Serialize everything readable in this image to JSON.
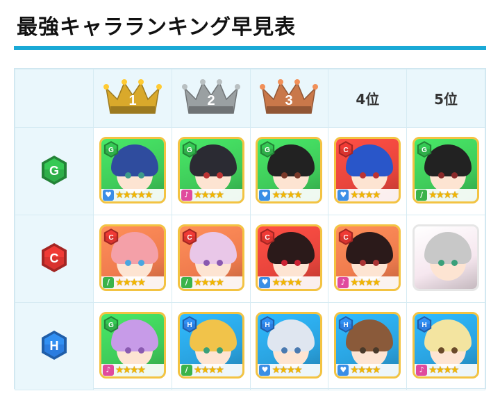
{
  "title": "最強キャラランキング早見表",
  "columns": [
    {
      "rank_label": "1",
      "crown_color": "#d9a92b"
    },
    {
      "rank_label": "2",
      "crown_color": "#9aa0a2"
    },
    {
      "rank_label": "3",
      "crown_color": "#c9784a"
    },
    {
      "rank_label": "4位"
    },
    {
      "rank_label": "5位"
    }
  ],
  "rows": [
    {
      "attr_letter": "G",
      "attr_color": "#2fae49",
      "cards": [
        {
          "attr": "G",
          "type_icon": "heart-icon",
          "type_color": "#3a8ee6",
          "stars": "★★★★★",
          "bg": "#3fcb5a",
          "hair": "#2f4c9e",
          "eye": "#3d9b8a"
        },
        {
          "attr": "G",
          "type_icon": "note-icon",
          "type_color": "#e04a9d",
          "stars": "★★★★",
          "bg": "#3fcb5a",
          "hair": "#2b2b33",
          "eye": "#b33"
        },
        {
          "attr": "G",
          "type_icon": "heart-icon",
          "type_color": "#3a8ee6",
          "stars": "★★★★",
          "bg": "#3fcb5a",
          "hair": "#222",
          "eye": "#7a3a2a"
        },
        {
          "attr": "C",
          "type_icon": "heart-icon",
          "type_color": "#3a8ee6",
          "stars": "★★★★",
          "bg": "#e8453c",
          "hair": "#2956c9",
          "eye": "#b33"
        },
        {
          "attr": "G",
          "type_icon": "sword-icon",
          "type_color": "#3bb34a",
          "stars": "★★★★",
          "bg": "#3fcb5a",
          "hair": "#222",
          "eye": "#8a2a2a"
        }
      ]
    },
    {
      "attr_letter": "C",
      "attr_color": "#d9332e",
      "cards": [
        {
          "attr": "C",
          "type_icon": "sword-icon",
          "type_color": "#3bb34a",
          "stars": "★★★★",
          "bg": "#f07c4e",
          "hair": "#f4a0a8",
          "eye": "#4aa6e0"
        },
        {
          "attr": "C",
          "type_icon": "sword-icon",
          "type_color": "#3bb34a",
          "stars": "★★★★",
          "bg": "#f07c4e",
          "hair": "#e9c7e8",
          "eye": "#8a5ab0"
        },
        {
          "attr": "C",
          "type_icon": "heart-icon",
          "type_color": "#3a8ee6",
          "stars": "★★★★",
          "bg": "#e8453c",
          "hair": "#2b1a1a",
          "eye": "#c23"
        },
        {
          "attr": "C",
          "type_icon": "note-icon",
          "type_color": "#e04a9d",
          "stars": "★★★★",
          "bg": "#f07c4e",
          "hair": "#2b1a1a",
          "eye": "#a33"
        },
        {
          "attr": "",
          "type_icon": "",
          "type_color": "#ffffff",
          "stars": "",
          "bg": "#f6e7ef",
          "hair": "#c8c8c8",
          "eye": "#3aa07a"
        }
      ]
    },
    {
      "attr_letter": "H",
      "attr_color": "#2b7de0",
      "cards": [
        {
          "attr": "G",
          "type_icon": "note-icon",
          "type_color": "#e04a9d",
          "stars": "★★★★",
          "bg": "#3fcb5a",
          "hair": "#c79be8",
          "eye": "#8a5ab0"
        },
        {
          "attr": "H",
          "type_icon": "sword-icon",
          "type_color": "#3bb34a",
          "stars": "★★★★",
          "bg": "#2aa3e0",
          "hair": "#f1c34a",
          "eye": "#3aa07a"
        },
        {
          "attr": "H",
          "type_icon": "heart-icon",
          "type_color": "#3a8ee6",
          "stars": "★★★★",
          "bg": "#2aa3e0",
          "hair": "#dfe6f0",
          "eye": "#4a7ab0"
        },
        {
          "attr": "H",
          "type_icon": "heart-icon",
          "type_color": "#3a8ee6",
          "stars": "★★★★",
          "bg": "#2aa3e0",
          "hair": "#8a5a3a",
          "eye": "#4a3a2a"
        },
        {
          "attr": "H",
          "type_icon": "note-icon",
          "type_color": "#e04a9d",
          "stars": "★★★★",
          "bg": "#2aa3e0",
          "hair": "#f3e4a0",
          "eye": "#6a4a2a"
        }
      ]
    }
  ]
}
